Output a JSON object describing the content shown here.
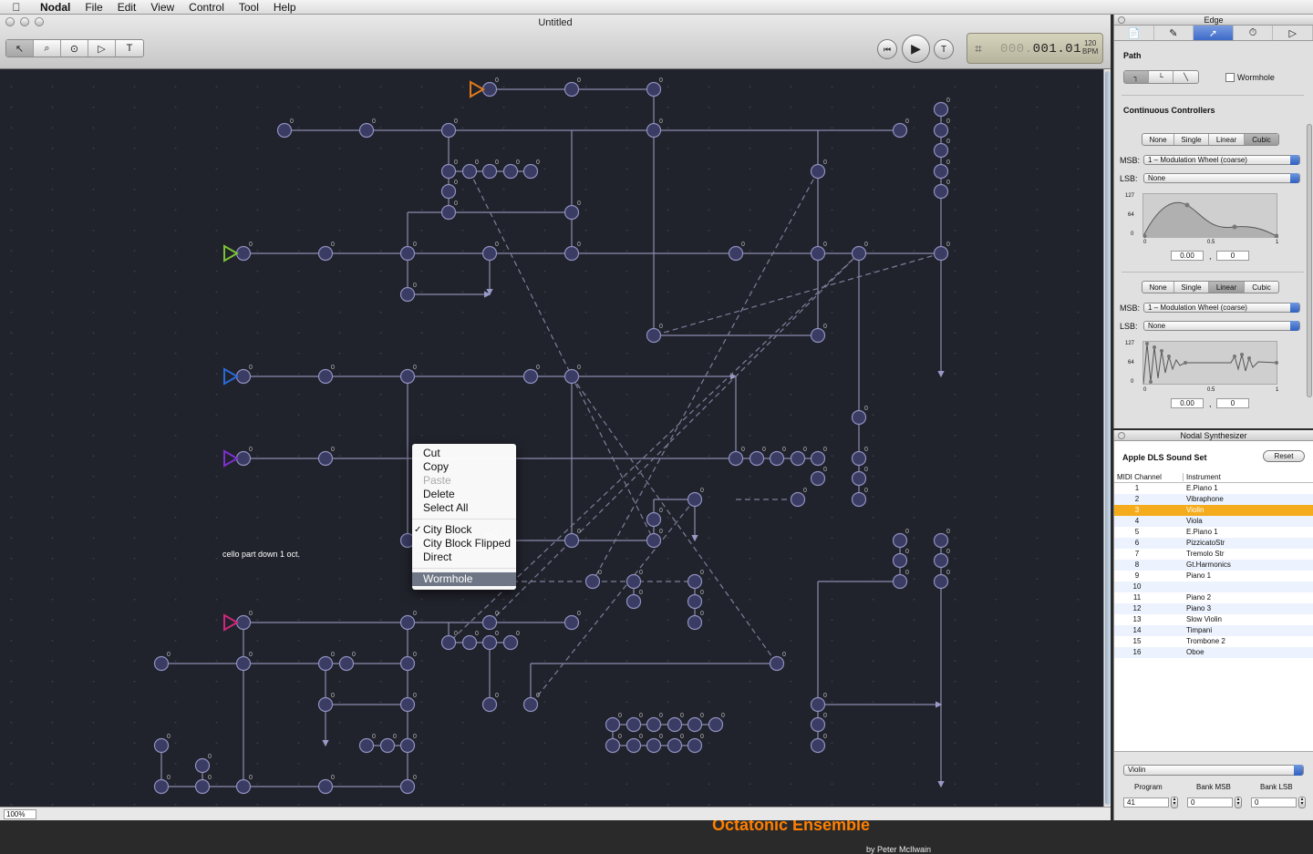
{
  "menubar": {
    "apple_icon": "apple-icon",
    "app_name": "Nodal",
    "items": [
      "File",
      "Edit",
      "View",
      "Control",
      "Tool",
      "Help"
    ]
  },
  "window": {
    "title": "Untitled"
  },
  "toolbar": {
    "tools": [
      {
        "name": "pointer-tool",
        "glyph": "↖"
      },
      {
        "name": "zoom-tool",
        "glyph": "⌕"
      },
      {
        "name": "node-tool",
        "glyph": "⊙"
      },
      {
        "name": "start-tool",
        "glyph": "▷"
      },
      {
        "name": "text-tool",
        "glyph": "T"
      }
    ]
  },
  "transport": {
    "rewind_icon": "⏮",
    "play_icon": "▶",
    "t_label": "T",
    "position_dim": "000.",
    "position": "001.01",
    "bpm_value": "120",
    "bpm_label": "BPM"
  },
  "canvas": {
    "note": "cello part down 1 oct.",
    "title": "Octatonic Ensemble",
    "byline": "by Peter McIlwain",
    "node_label": "0",
    "start_colors": [
      "#e07b1a",
      "#7bc234",
      "#2a6ad8",
      "#7d2fd0",
      "#d0277a"
    ]
  },
  "context_menu": {
    "items": [
      {
        "label": "Cut",
        "enabled": true
      },
      {
        "label": "Copy",
        "enabled": true
      },
      {
        "label": "Paste",
        "enabled": false
      },
      {
        "label": "Delete",
        "enabled": true
      },
      {
        "label": "Select All",
        "enabled": true
      }
    ],
    "options": [
      {
        "label": "City Block",
        "checked": true
      },
      {
        "label": "City Block Flipped",
        "checked": false
      },
      {
        "label": "Direct",
        "checked": false
      }
    ],
    "highlighted": "Wormhole"
  },
  "statusbar": {
    "zoom": "100%"
  },
  "edge_panel": {
    "title": "Edge",
    "tabs": [
      "📄",
      "✎",
      "➚",
      "⏱",
      "▷"
    ],
    "path_label": "Path",
    "path_buttons": [
      "┐",
      "└",
      "╲"
    ],
    "wormhole_label": "Wormhole",
    "cc_label": "Continuous Controllers",
    "cc1": {
      "modes": [
        "None",
        "Single",
        "Linear",
        "Cubic"
      ],
      "active": "Cubic",
      "msb_label": "MSB:",
      "msb_value": "1 – Modulation Wheel (coarse)",
      "lsb_label": "LSB:",
      "lsb_value": "None",
      "y_ticks": [
        "127",
        "64",
        "0"
      ],
      "x_ticks": [
        "0",
        "0.5",
        "1"
      ],
      "start": "0.00",
      "end": "0"
    },
    "cc2": {
      "modes": [
        "None",
        "Single",
        "Linear",
        "Cubic"
      ],
      "active": "Linear",
      "msb_label": "MSB:",
      "msb_value": "1 – Modulation Wheel (coarse)",
      "lsb_label": "LSB:",
      "lsb_value": "None",
      "y_ticks": [
        "127",
        "64",
        "0"
      ],
      "x_ticks": [
        "0",
        "0.5",
        "1"
      ],
      "start": "0.00",
      "end": "0"
    }
  },
  "synth_panel": {
    "title": "Nodal Synthesizer",
    "sound_set": "Apple DLS Sound Set",
    "reset_label": "Reset",
    "col_channel": "MIDI Channel",
    "col_instrument": "Instrument",
    "rows": [
      {
        "ch": "1",
        "inst": "E.Piano 1"
      },
      {
        "ch": "2",
        "inst": "Vibraphone"
      },
      {
        "ch": "3",
        "inst": "Violin"
      },
      {
        "ch": "4",
        "inst": "Viola"
      },
      {
        "ch": "5",
        "inst": "E.Piano 1"
      },
      {
        "ch": "6",
        "inst": "PizzicatoStr"
      },
      {
        "ch": "7",
        "inst": "Tremolo Str"
      },
      {
        "ch": "8",
        "inst": "Gt.Harmonics"
      },
      {
        "ch": "9",
        "inst": "Piano 1"
      },
      {
        "ch": "10",
        "inst": ""
      },
      {
        "ch": "11",
        "inst": "Piano 2"
      },
      {
        "ch": "12",
        "inst": "Piano 3"
      },
      {
        "ch": "13",
        "inst": "Slow Violin"
      },
      {
        "ch": "14",
        "inst": "Timpani"
      },
      {
        "ch": "15",
        "inst": "Trombone 2"
      },
      {
        "ch": "16",
        "inst": "Oboe"
      }
    ],
    "selected_channel": "3",
    "instrument_popup": "Violin",
    "program_label": "Program",
    "program_value": "41",
    "bank_msb_label": "Bank MSB",
    "bank_msb_value": "0",
    "bank_lsb_label": "Bank LSB",
    "bank_lsb_value": "0"
  }
}
